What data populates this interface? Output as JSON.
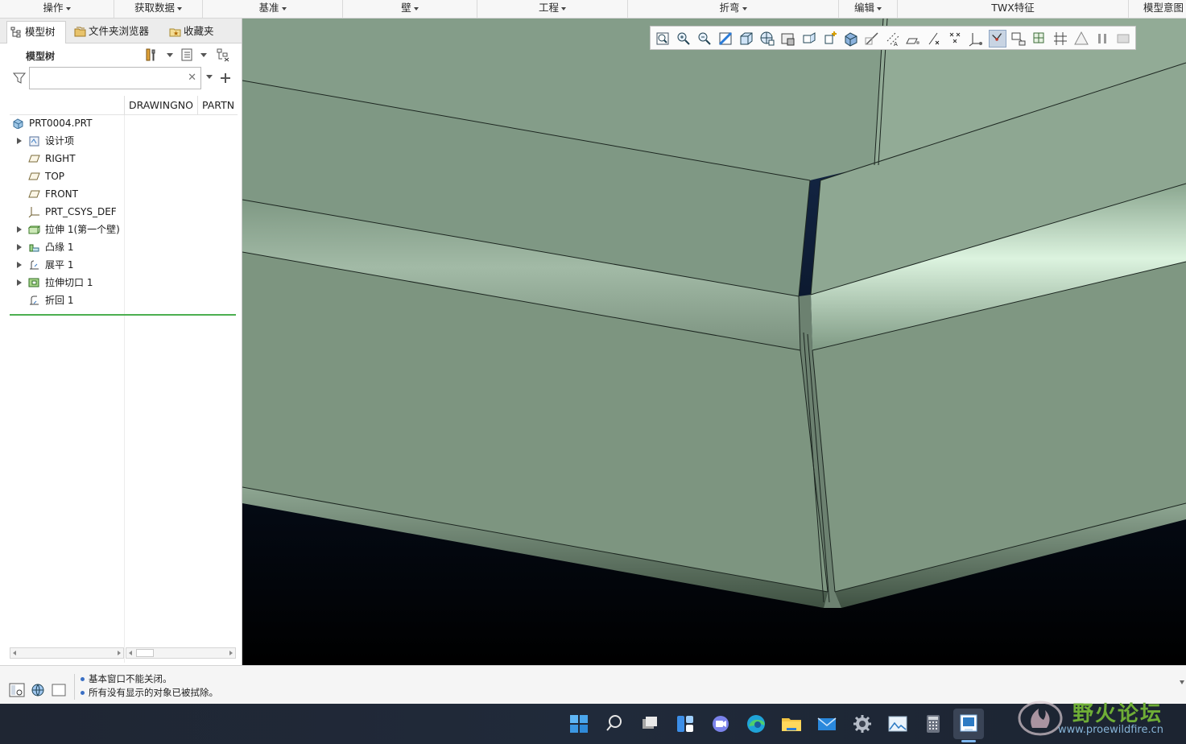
{
  "ribbon": {
    "groups": [
      {
        "label": "操作",
        "dropdown": true
      },
      {
        "label": "获取数据",
        "dropdown": true
      },
      {
        "label": "基准",
        "dropdown": true
      },
      {
        "label": "壁",
        "dropdown": true
      },
      {
        "label": "工程",
        "dropdown": true
      },
      {
        "label": "折弯",
        "dropdown": true
      },
      {
        "label": "编辑",
        "dropdown": true
      },
      {
        "label": "TWX特征",
        "dropdown": false
      },
      {
        "label": "模型意图",
        "dropdown": false
      }
    ]
  },
  "left_panel": {
    "tabs": [
      {
        "label": "模型树",
        "icon": "model-tree-icon",
        "active": true
      },
      {
        "label": "文件夹浏览器",
        "icon": "folder-browser-icon",
        "active": false
      },
      {
        "label": "收藏夹",
        "icon": "favorites-icon",
        "active": false
      }
    ],
    "tree_title": "模型树",
    "search": {
      "value": "",
      "placeholder": ""
    },
    "columns": [
      "DRAWINGNO",
      "PARTN"
    ],
    "items": [
      {
        "label": "PRT0004.PRT",
        "icon": "part-icon",
        "expandable": false,
        "indent": 0
      },
      {
        "label": "设计项",
        "icon": "design-items-icon",
        "expandable": true,
        "indent": 1
      },
      {
        "label": "RIGHT",
        "icon": "datum-plane-icon",
        "expandable": false,
        "indent": 1
      },
      {
        "label": "TOP",
        "icon": "datum-plane-icon",
        "expandable": false,
        "indent": 1
      },
      {
        "label": "FRONT",
        "icon": "datum-plane-icon",
        "expandable": false,
        "indent": 1
      },
      {
        "label": "PRT_CSYS_DEF",
        "icon": "csys-icon",
        "expandable": false,
        "indent": 1
      },
      {
        "label": "拉伸 1(第一个壁)",
        "icon": "extrude-wall-icon",
        "expandable": true,
        "indent": 1
      },
      {
        "label": "凸缘 1",
        "icon": "flange-icon",
        "expandable": true,
        "indent": 1
      },
      {
        "label": "展平 1",
        "icon": "unbend-icon",
        "expandable": true,
        "indent": 1
      },
      {
        "label": "拉伸切口 1",
        "icon": "extrude-cut-icon",
        "expandable": true,
        "indent": 1
      },
      {
        "label": "折回 1",
        "icon": "bend-back-icon",
        "expandable": false,
        "indent": 1
      }
    ]
  },
  "view_toolbar": {
    "icons": [
      "refit-icon",
      "zoom-in-icon",
      "zoom-out-icon",
      "repaint-icon",
      "display-style-icon",
      "saved-orientations-icon",
      "view-manager-icon",
      "perspective-view-icon",
      "spin-center-icon",
      "section-icon",
      "datum-display-icon",
      "plane-display-icon",
      "axis-display-icon",
      "point-display-icon",
      "csys-display-icon",
      "annotation-display-icon",
      "sheetmetal-edge-icon",
      "bend-lines-icon",
      "unbend-preview-icon",
      "flat-state-icon",
      "warning-icon",
      "pause-icon",
      "stop-icon"
    ],
    "active_index": 16
  },
  "messages": [
    "基本窗口不能关闭。",
    "所有没有显示的对象已被拭除。"
  ],
  "taskbar": {
    "icons": [
      "windows-start-icon",
      "search-icon",
      "task-view-icon",
      "widgets-icon",
      "teams-chat-icon",
      "edge-browser-icon",
      "file-explorer-icon",
      "mail-icon",
      "settings-icon",
      "photos-icon",
      "calculator-icon",
      "creo-app-icon"
    ],
    "active": "creo-app-icon"
  },
  "watermark": {
    "title": "野火论坛",
    "url": "www.proewildfire.cn"
  },
  "colors": {
    "part_surface": "#839a87",
    "part_edge": "#1c2620",
    "background_top": "#1a3258",
    "background_bottom": "#000000",
    "accent_green": "#4caf50",
    "watermark_green": "#6fae36"
  }
}
